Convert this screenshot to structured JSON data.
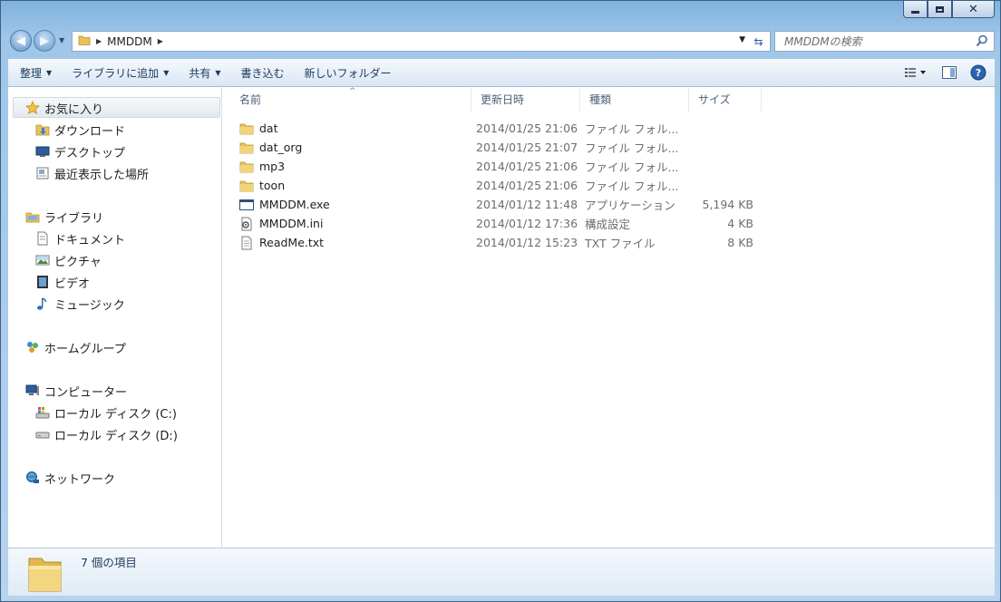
{
  "address": {
    "crumbs": [
      "MMDDM"
    ]
  },
  "search": {
    "placeholder": "MMDDMの検索"
  },
  "toolbar": {
    "organize": "整理",
    "add_to_library": "ライブラリに追加",
    "share": "共有",
    "burn": "書き込む",
    "new_folder": "新しいフォルダー"
  },
  "sidebar": {
    "favorites": {
      "label": "お気に入り",
      "items": [
        "ダウンロード",
        "デスクトップ",
        "最近表示した場所"
      ]
    },
    "libraries": {
      "label": "ライブラリ",
      "items": [
        "ドキュメント",
        "ピクチャ",
        "ビデオ",
        "ミュージック"
      ]
    },
    "homegroup": {
      "label": "ホームグループ"
    },
    "computer": {
      "label": "コンピューター",
      "items": [
        "ローカル ディスク (C:)",
        "ローカル ディスク (D:)"
      ]
    },
    "network": {
      "label": "ネットワーク"
    }
  },
  "columns": {
    "name": "名前",
    "date": "更新日時",
    "type": "種類",
    "size": "サイズ"
  },
  "files": [
    {
      "name": "dat",
      "date": "2014/01/25 21:06",
      "type": "ファイル フォル...",
      "size": "",
      "icon": "folder-icon"
    },
    {
      "name": "dat_org",
      "date": "2014/01/25 21:07",
      "type": "ファイル フォル...",
      "size": "",
      "icon": "folder-icon"
    },
    {
      "name": "mp3",
      "date": "2014/01/25 21:06",
      "type": "ファイル フォル...",
      "size": "",
      "icon": "folder-icon"
    },
    {
      "name": "toon",
      "date": "2014/01/25 21:06",
      "type": "ファイル フォル...",
      "size": "",
      "icon": "folder-icon"
    },
    {
      "name": "MMDDM.exe",
      "date": "2014/01/12 11:48",
      "type": "アプリケーション",
      "size": "5,194 KB",
      "icon": "application-icon"
    },
    {
      "name": "MMDDM.ini",
      "date": "2014/01/12 17:36",
      "type": "構成設定",
      "size": "4 KB",
      "icon": "settings-file-icon"
    },
    {
      "name": "ReadMe.txt",
      "date": "2014/01/12 15:23",
      "type": "TXT ファイル",
      "size": "8 KB",
      "icon": "text-file-icon"
    }
  ],
  "status": {
    "item_count": "7 個の項目"
  },
  "colors": {
    "accent": "#1e395b",
    "selection": "#e3e9ee",
    "folder": "#e8c35a"
  }
}
